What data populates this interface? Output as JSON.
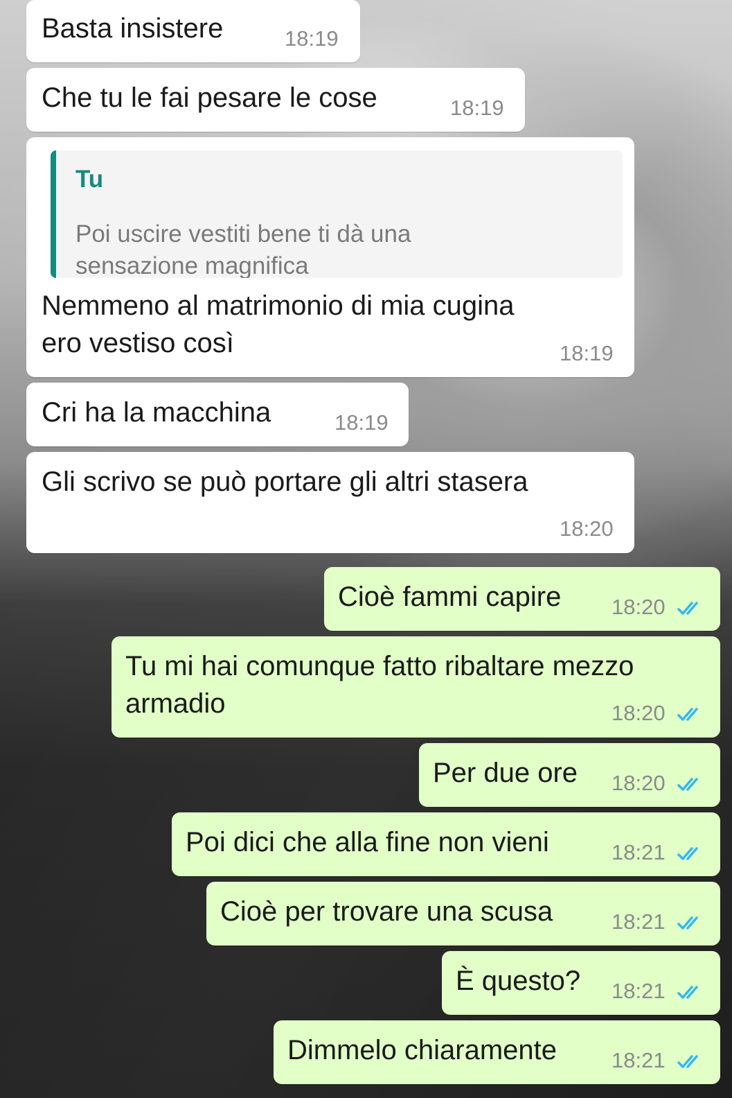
{
  "chat": {
    "colors": {
      "incoming_bubble": "#ffffff",
      "outgoing_bubble": "#e1ffc7",
      "quote_accent": "#128c7e",
      "read_ticks": "#34b7f1"
    },
    "incoming": [
      {
        "line1": "Basta insistere",
        "time": "18:19"
      },
      {
        "line1": "Che tu le fai pesare le cose",
        "time": "18:19"
      },
      {
        "quote_author": "Tu",
        "quote_line1": "Poi uscire vestiti bene ti dà una",
        "quote_line2": "sensazione magnifica",
        "line1": "Nemmeno al matrimonio di mia cugina",
        "line2": "ero vestiso così",
        "time": "18:19"
      },
      {
        "line1": "Cri ha la macchina",
        "time": "18:19"
      },
      {
        "line1": "Gli scrivo se può portare gli altri stasera",
        "time": "18:20"
      }
    ],
    "outgoing": [
      {
        "line1": "Cioè fammi capire",
        "time": "18:20",
        "status": "read"
      },
      {
        "line1": "Tu mi hai comunque fatto ribaltare mezzo",
        "line2": "armadio",
        "time": "18:20",
        "status": "read"
      },
      {
        "line1": "Per due ore",
        "time": "18:20",
        "status": "read"
      },
      {
        "line1": "Poi dici che alla fine non vieni",
        "time": "18:21",
        "status": "read"
      },
      {
        "line1": "Cioè per trovare una scusa",
        "time": "18:21",
        "status": "read"
      },
      {
        "line1": "È questo?",
        "time": "18:21",
        "status": "read"
      },
      {
        "line1": "Dimmelo chiaramente",
        "time": "18:21",
        "status": "read"
      }
    ]
  }
}
